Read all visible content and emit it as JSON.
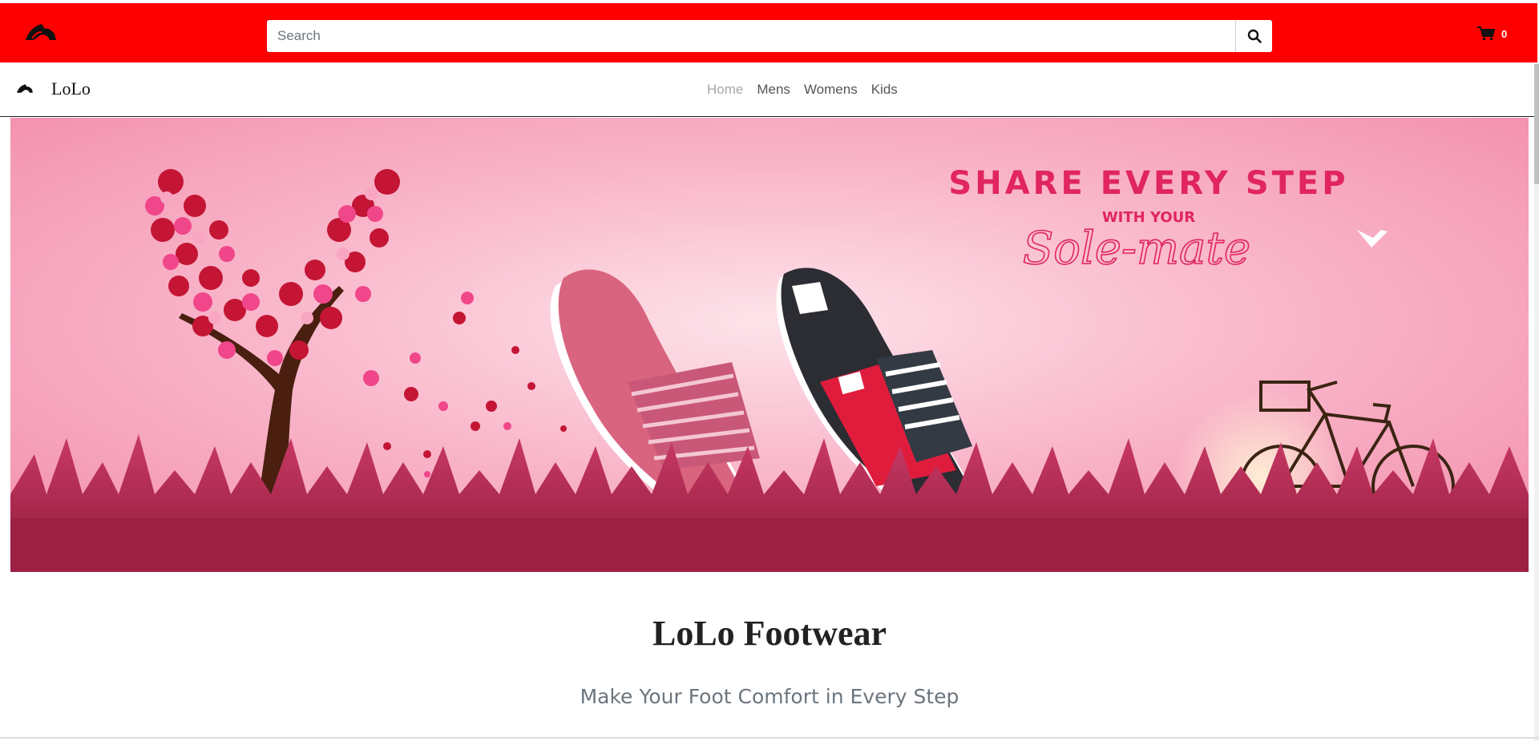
{
  "header": {
    "logo_icon": "shoe-logo-icon",
    "search": {
      "placeholder": "Search",
      "value": "",
      "button_icon": "search-icon"
    },
    "cart": {
      "icon": "cart-icon",
      "count": "0"
    }
  },
  "navbar": {
    "brand_icon": "shoe-logo-icon",
    "brand_name": "LoLo",
    "links": [
      {
        "label": "Home",
        "active": true
      },
      {
        "label": "Mens",
        "active": false
      },
      {
        "label": "Womens",
        "active": false
      },
      {
        "label": "Kids",
        "active": false
      }
    ]
  },
  "hero": {
    "headline": "SHARE EVERY STEP",
    "subline": "WITH YOUR",
    "script_line": "Sole-mate",
    "colors": {
      "background": "#f7a6c0",
      "headline": "#e0255f",
      "grass": "#b8264f"
    }
  },
  "main": {
    "title": "LoLo Footwear",
    "tagline": "Make Your Foot Comfort in Every Step"
  },
  "colors": {
    "topbar": "#ff0000",
    "nav_active": "#a6a6a6",
    "nav_link": "#555555"
  }
}
